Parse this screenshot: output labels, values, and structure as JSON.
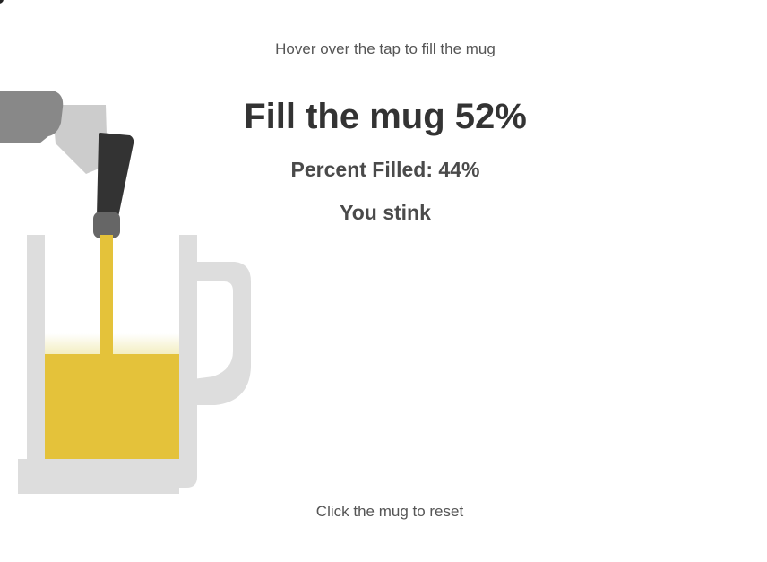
{
  "instructions": {
    "hover_hint": "Hover over the tap to fill the mug",
    "reset_hint": "Click the mug to reset"
  },
  "game": {
    "title": "Fill the mug 52%",
    "percent_filled": "Percent Filled: 44%",
    "verdict": "You stink",
    "fill_fraction": 0.44
  },
  "colors": {
    "beer": "#e4c23a",
    "foam": "#f6f2cc",
    "glass": "#dddddd",
    "tap_body": "#888888",
    "tap_bracket": "#cccccc",
    "tap_handle": "#333333",
    "tap_nozzle": "#666666"
  },
  "icons": {
    "tap": "beer-tap-icon",
    "mug": "beer-mug-icon"
  }
}
